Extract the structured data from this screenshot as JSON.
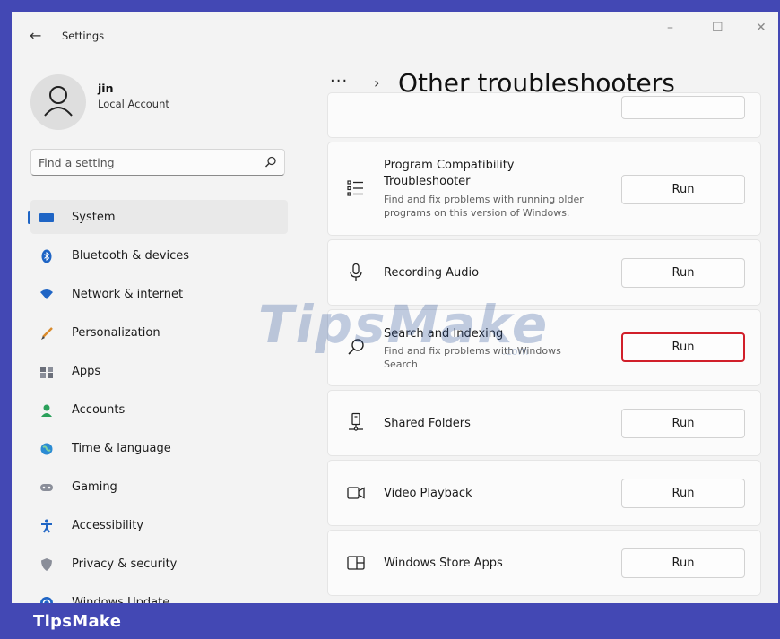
{
  "titlebar": {
    "back_glyph": "←",
    "title": "Settings",
    "min": "–",
    "max": "☐",
    "close": "✕"
  },
  "account": {
    "name": "jin",
    "type": "Local Account"
  },
  "search": {
    "placeholder": "Find a setting"
  },
  "nav": [
    {
      "label": "System",
      "icon": "system-icon",
      "selected": true
    },
    {
      "label": "Bluetooth & devices",
      "icon": "bluetooth-icon"
    },
    {
      "label": "Network & internet",
      "icon": "network-icon"
    },
    {
      "label": "Personalization",
      "icon": "brush-icon"
    },
    {
      "label": "Apps",
      "icon": "apps-icon"
    },
    {
      "label": "Accounts",
      "icon": "accounts-icon"
    },
    {
      "label": "Time & language",
      "icon": "globe-icon"
    },
    {
      "label": "Gaming",
      "icon": "gamepad-icon"
    },
    {
      "label": "Accessibility",
      "icon": "accessibility-icon"
    },
    {
      "label": "Privacy & security",
      "icon": "shield-icon"
    },
    {
      "label": "Windows Update",
      "icon": "update-icon"
    }
  ],
  "breadcrumb": {
    "dots": "···",
    "arrow": "›",
    "title": "Other troubleshooters"
  },
  "troubleshooters": [
    {
      "title_line1": "Program Compatibility",
      "title_line2": "Troubleshooter",
      "desc_line1": "Find and fix problems with running older",
      "desc_line2": "programs on this version of Windows.",
      "icon": "list-icon",
      "button": "Run"
    },
    {
      "title": "Recording Audio",
      "icon": "microphone-icon",
      "button": "Run"
    },
    {
      "title": "Search and Indexing",
      "desc_line1": "Find and fix problems with Windows",
      "desc_line2": "Search",
      "icon": "search-icon",
      "button": "Run",
      "highlighted": true
    },
    {
      "title": "Shared Folders",
      "icon": "shared-folder-icon",
      "button": "Run"
    },
    {
      "title": "Video Playback",
      "icon": "video-icon",
      "button": "Run"
    },
    {
      "title": "Windows Store Apps",
      "icon": "store-apps-icon",
      "button": "Run"
    }
  ],
  "watermark": {
    "main": "TipsMake",
    "sub": ".com"
  },
  "footer": {
    "brand": "TipsMake"
  },
  "colors": {
    "accent": "#1f65c5",
    "frame": "#4348b4",
    "highlight": "#d11f2a"
  }
}
